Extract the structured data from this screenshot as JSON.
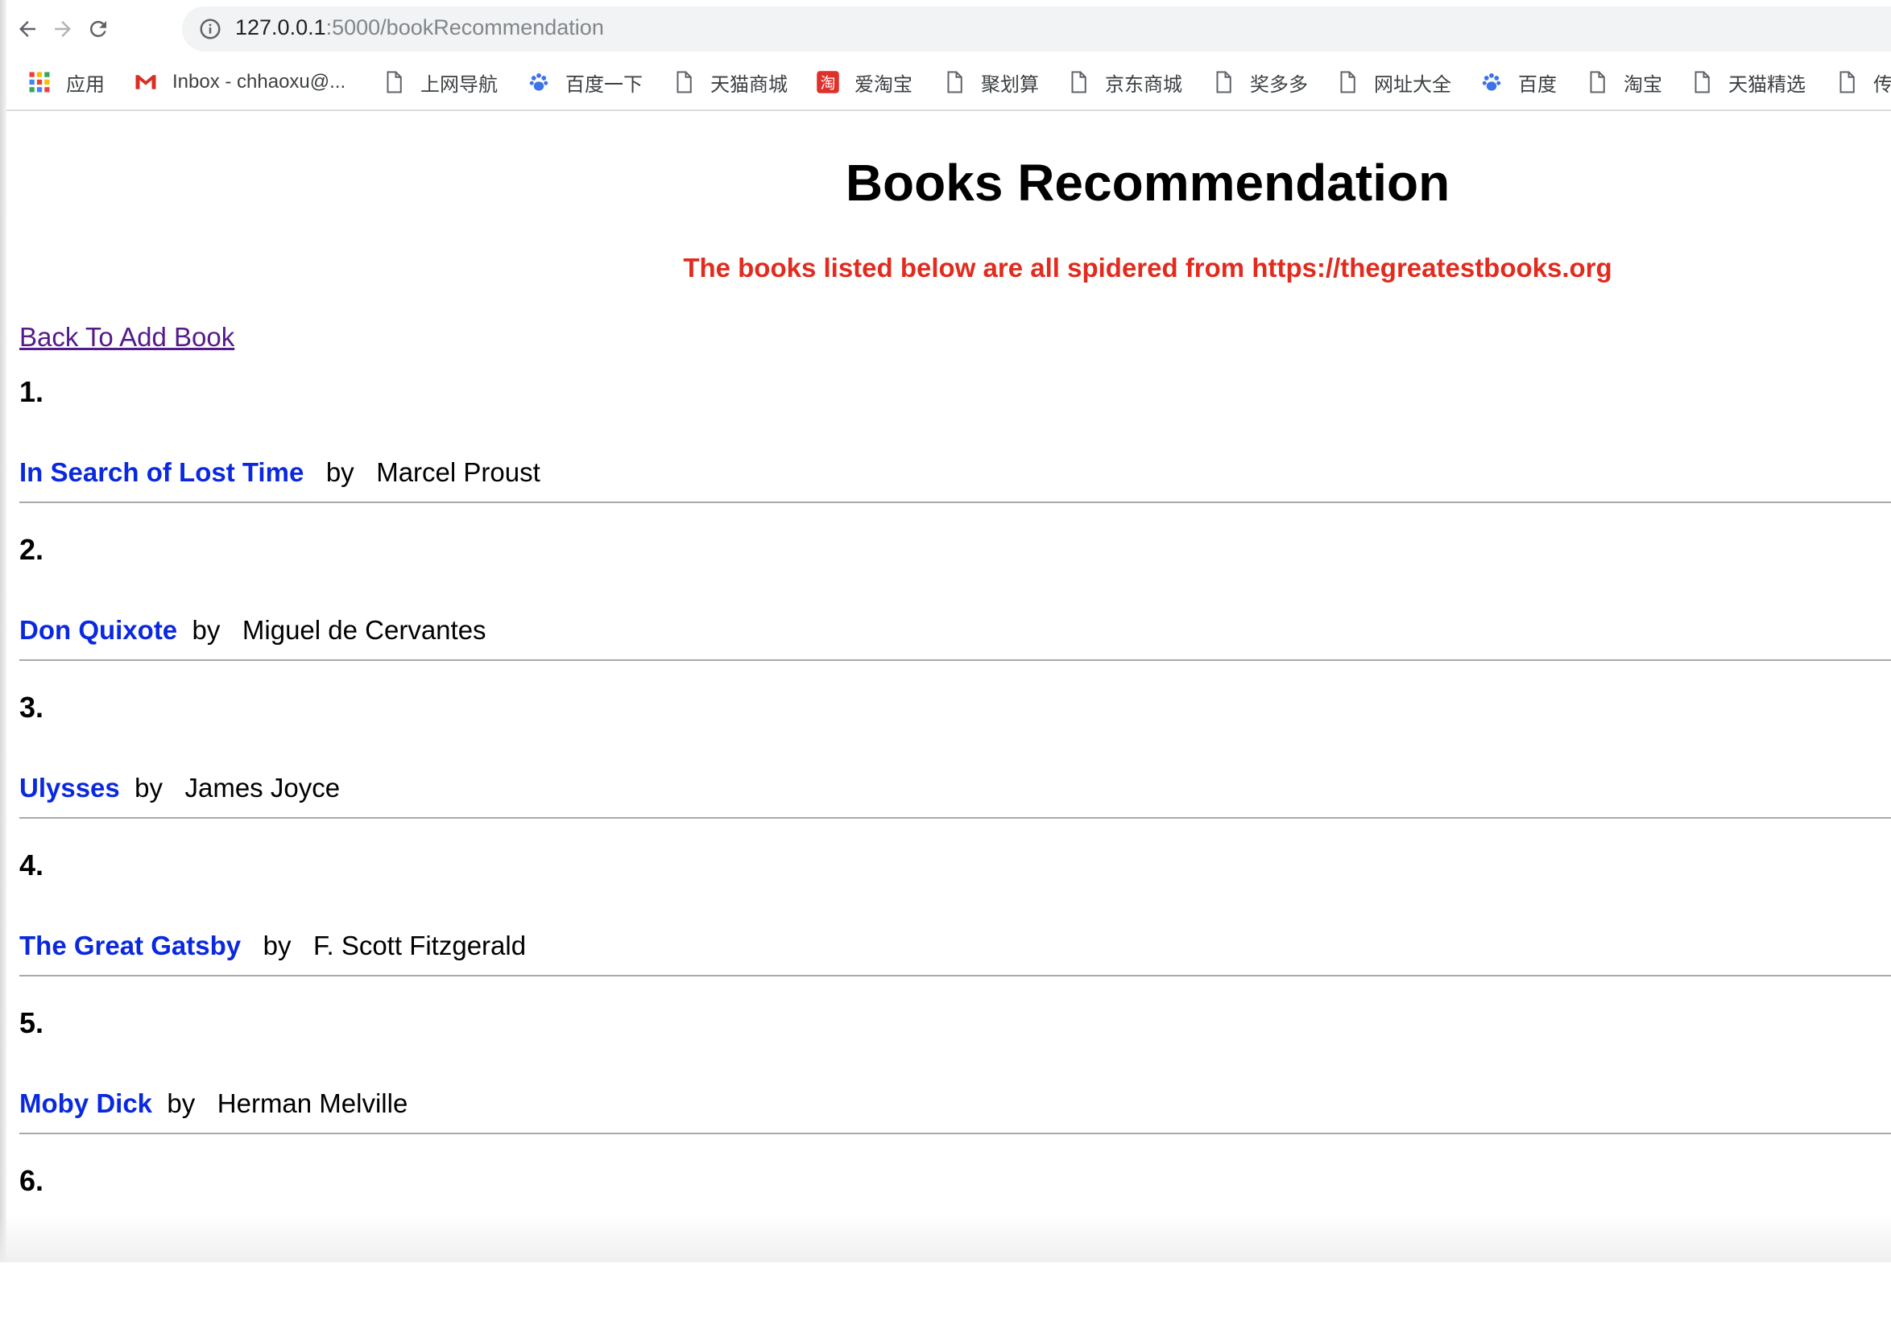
{
  "browser": {
    "url_host": "127.0.0.1",
    "url_path": ":5000/bookRecommendation"
  },
  "bookmarks": [
    {
      "label": "应用",
      "icon": "apps-grid-icon"
    },
    {
      "label": "Inbox - chhaoxu@...",
      "icon": "gmail-icon"
    },
    {
      "label": "上网导航",
      "icon": "page-icon"
    },
    {
      "label": "百度一下",
      "icon": "baidu-paw-icon"
    },
    {
      "label": "天猫商城",
      "icon": "page-icon"
    },
    {
      "label": "爱淘宝",
      "icon": "taobao-icon"
    },
    {
      "label": "聚划算",
      "icon": "page-icon"
    },
    {
      "label": "京东商城",
      "icon": "page-icon"
    },
    {
      "label": "奖多多",
      "icon": "page-icon"
    },
    {
      "label": "网址大全",
      "icon": "page-icon"
    },
    {
      "label": "百度",
      "icon": "baidu-paw-icon"
    },
    {
      "label": "淘宝",
      "icon": "page-icon"
    },
    {
      "label": "天猫精选",
      "icon": "page-icon"
    },
    {
      "label": "传",
      "icon": "page-icon"
    }
  ],
  "page": {
    "title": "Books Recommendation",
    "subtitle": "The books listed below are all spidered from https://thegreatestbooks.org",
    "back_link": "Back To Add Book",
    "by_word": "by"
  },
  "books": [
    {
      "number": "1.",
      "title": "In Search of Lost Time",
      "author": "Marcel Proust"
    },
    {
      "number": "2.",
      "title": "Don Quixote",
      "author": "Miguel de Cervantes"
    },
    {
      "number": "3.",
      "title": "Ulysses",
      "author": "James Joyce"
    },
    {
      "number": "4.",
      "title": "The Great Gatsby",
      "author": "F. Scott Fitzgerald"
    },
    {
      "number": "5.",
      "title": "Moby Dick",
      "author": "Herman Melville"
    },
    {
      "number": "6.",
      "title": "",
      "author": ""
    }
  ],
  "colors": {
    "subtitle": "#e22b1e",
    "book_link": "#0a28e0",
    "visited_link": "#551a8b"
  }
}
